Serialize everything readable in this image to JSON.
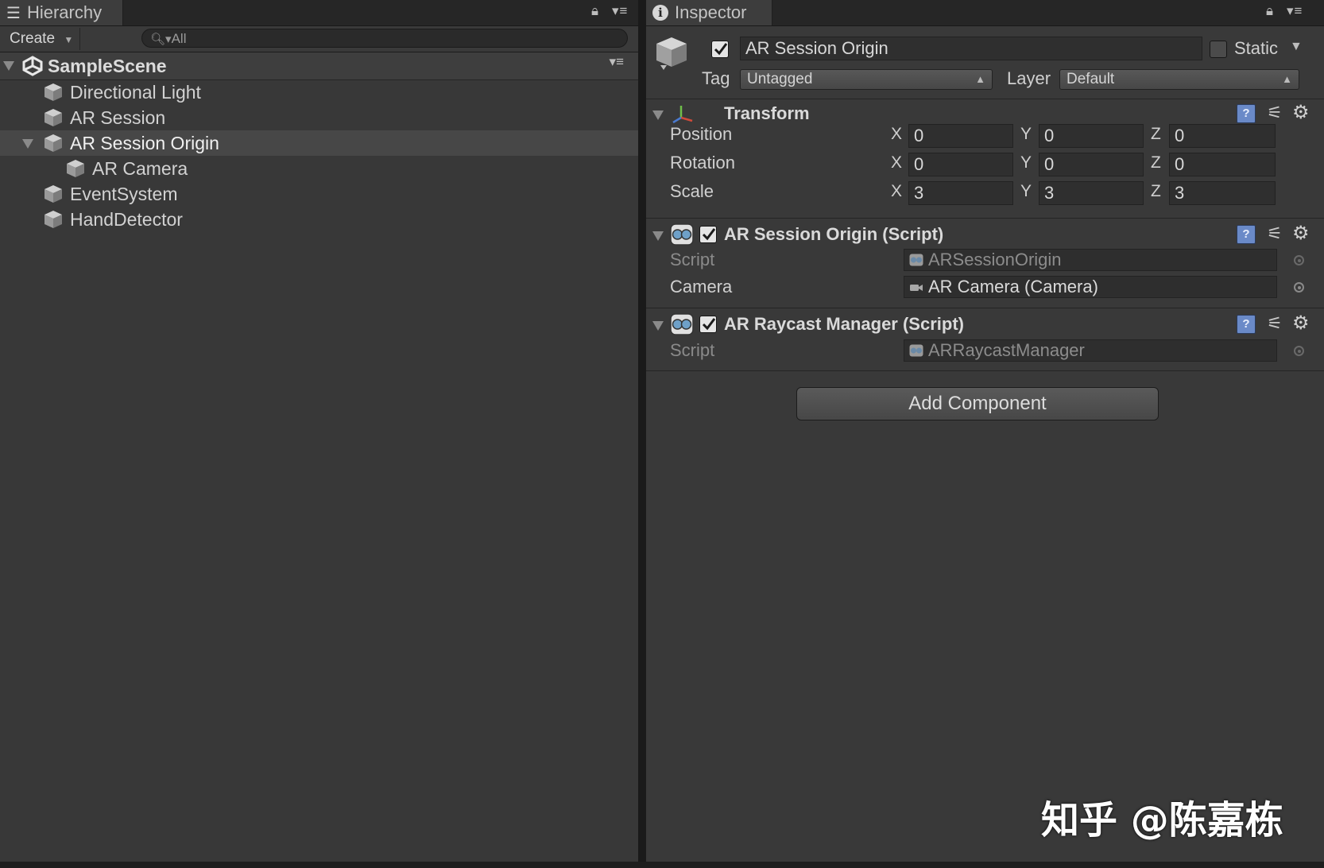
{
  "hierarchy": {
    "tab_label": "Hierarchy",
    "create_label": "Create",
    "search_placeholder": "All",
    "scene_name": "SampleScene",
    "items": [
      {
        "label": "Directional Light",
        "depth": 1,
        "selected": false
      },
      {
        "label": "AR Session",
        "depth": 1,
        "selected": false
      },
      {
        "label": "AR Session Origin",
        "depth": 1,
        "selected": true,
        "expanded": true
      },
      {
        "label": "AR Camera",
        "depth": 2,
        "selected": false
      },
      {
        "label": "EventSystem",
        "depth": 1,
        "selected": false
      },
      {
        "label": "HandDetector",
        "depth": 1,
        "selected": false
      }
    ]
  },
  "inspector": {
    "tab_label": "Inspector",
    "object_name": "AR Session Origin",
    "static_label": "Static",
    "tag_label": "Tag",
    "tag_value": "Untagged",
    "layer_label": "Layer",
    "layer_value": "Default",
    "transform": {
      "title": "Transform",
      "rows": [
        {
          "label": "Position",
          "x": "0",
          "y": "0",
          "z": "0"
        },
        {
          "label": "Rotation",
          "x": "0",
          "y": "0",
          "z": "0"
        },
        {
          "label": "Scale",
          "x": "3",
          "y": "3",
          "z": "3"
        }
      ],
      "axis_x": "X",
      "axis_y": "Y",
      "axis_z": "Z"
    },
    "session_origin": {
      "title": "AR Session Origin (Script)",
      "script_label": "Script",
      "script_value": "ARSessionOrigin",
      "camera_label": "Camera",
      "camera_value": "AR Camera (Camera)"
    },
    "raycast_manager": {
      "title": "AR Raycast Manager (Script)",
      "script_label": "Script",
      "script_value": "ARRaycastManager"
    },
    "add_component_label": "Add Component"
  },
  "watermark": "知乎 @陈嘉栋"
}
